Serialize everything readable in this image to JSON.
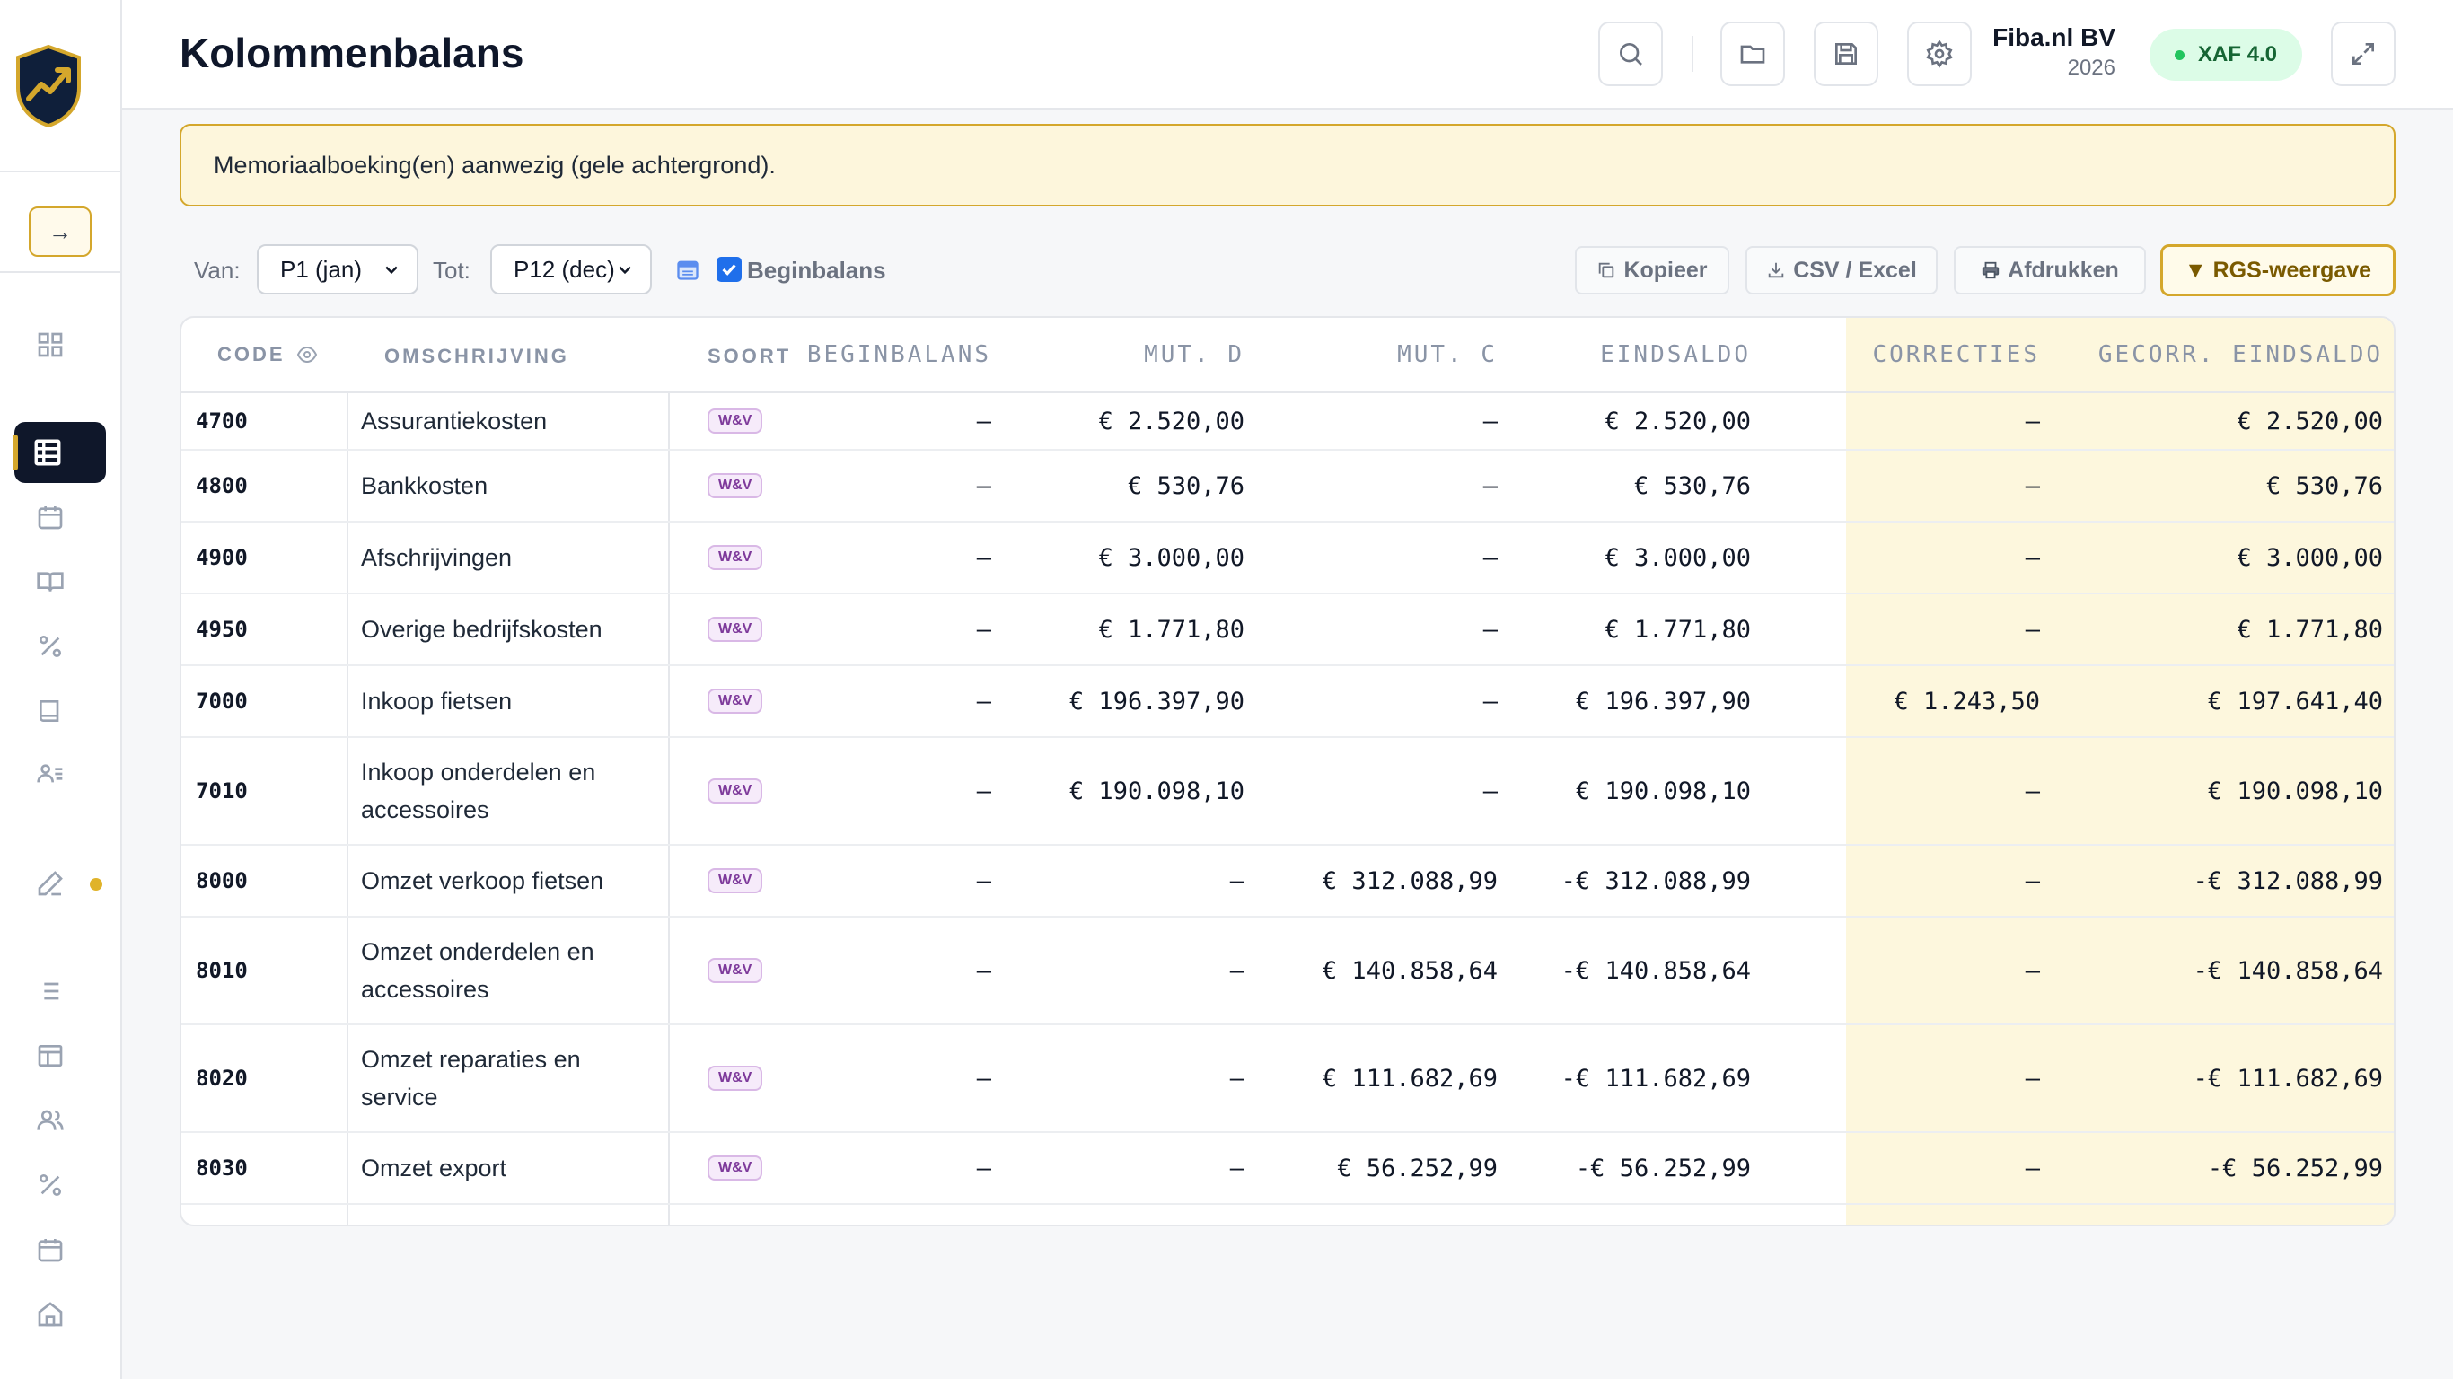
{
  "header": {
    "title": "Kolommenbalans",
    "company_name": "Fiba.nl BV",
    "company_year": "2026",
    "xaf_badge": "XAF 4.0"
  },
  "sidebar": {
    "expand_label": "→",
    "items": [
      {
        "icon": "grid-icon"
      },
      {
        "icon": "table-icon",
        "active": true
      },
      {
        "icon": "calendar-icon"
      },
      {
        "icon": "book-open-icon"
      },
      {
        "icon": "percent-icon"
      },
      {
        "icon": "book-icon"
      },
      {
        "icon": "user-list-icon"
      },
      {
        "icon": "pencil-icon",
        "badge": true
      },
      {
        "icon": "list-icon"
      },
      {
        "icon": "layout-icon"
      },
      {
        "icon": "users-icon"
      },
      {
        "icon": "percent-icon"
      },
      {
        "icon": "calendar-icon"
      },
      {
        "icon": "home-icon"
      }
    ]
  },
  "notice": "Memoriaalboeking(en) aanwezig (gele achtergrond).",
  "toolbar": {
    "from_label": "Van:",
    "from_value": "P1 (jan)",
    "to_label": "Tot:",
    "to_value": "P12 (dec)",
    "opening_balance_label": "Beginbalans",
    "opening_balance_checked": true,
    "copy_label": "Kopieer",
    "csv_label": "CSV / Excel",
    "print_label": "Afdrukken",
    "rgs_label": "▼ RGS-weergave"
  },
  "table": {
    "columns": {
      "code": "CODE",
      "description": "OMSCHRIJVING",
      "type": "SOORT",
      "opening": "BEGINBALANS",
      "debit": "MUT. D",
      "credit": "MUT. C",
      "closing": "EINDSALDO",
      "corrections": "CORRECTIES",
      "corrected": "GECORR. EINDSALDO"
    },
    "rows": [
      {
        "code": "4700",
        "desc": "Assurantiekosten",
        "type": "W&V",
        "opening": "–",
        "debit": "€ 2.520,00",
        "credit": "–",
        "closing": "€ 2.520,00",
        "corrections": "–",
        "corrected": "€ 2.520,00"
      },
      {
        "code": "4800",
        "desc": "Bankkosten",
        "type": "W&V",
        "opening": "–",
        "debit": "€ 530,76",
        "credit": "–",
        "closing": "€ 530,76",
        "corrections": "–",
        "corrected": "€ 530,76"
      },
      {
        "code": "4900",
        "desc": "Afschrijvingen",
        "type": "W&V",
        "opening": "–",
        "debit": "€ 3.000,00",
        "credit": "–",
        "closing": "€ 3.000,00",
        "corrections": "–",
        "corrected": "€ 3.000,00"
      },
      {
        "code": "4950",
        "desc": "Overige bedrijfskosten",
        "type": "W&V",
        "opening": "–",
        "debit": "€ 1.771,80",
        "credit": "–",
        "closing": "€ 1.771,80",
        "corrections": "–",
        "corrected": "€ 1.771,80"
      },
      {
        "code": "7000",
        "desc": "Inkoop fietsen",
        "type": "W&V",
        "opening": "–",
        "debit": "€ 196.397,90",
        "credit": "–",
        "closing": "€ 196.397,90",
        "corrections": "€ 1.243,50",
        "corrected": "€ 197.641,40"
      },
      {
        "code": "7010",
        "desc": "Inkoop onderdelen en accessoires",
        "type": "W&V",
        "opening": "–",
        "debit": "€ 190.098,10",
        "credit": "–",
        "closing": "€ 190.098,10",
        "corrections": "–",
        "corrected": "€ 190.098,10"
      },
      {
        "code": "8000",
        "desc": "Omzet verkoop fietsen",
        "type": "W&V",
        "opening": "–",
        "debit": "–",
        "credit": "€ 312.088,99",
        "closing": "-€ 312.088,99",
        "corrections": "–",
        "corrected": "-€ 312.088,99"
      },
      {
        "code": "8010",
        "desc": "Omzet onderdelen en accessoires",
        "type": "W&V",
        "opening": "–",
        "debit": "–",
        "credit": "€ 140.858,64",
        "closing": "-€ 140.858,64",
        "corrections": "–",
        "corrected": "-€ 140.858,64"
      },
      {
        "code": "8020",
        "desc": "Omzet reparaties en service",
        "type": "W&V",
        "opening": "–",
        "debit": "–",
        "credit": "€ 111.682,69",
        "closing": "-€ 111.682,69",
        "corrections": "–",
        "corrected": "-€ 111.682,69"
      },
      {
        "code": "8030",
        "desc": "Omzet export",
        "type": "W&V",
        "opening": "–",
        "debit": "–",
        "credit": "€ 56.252,99",
        "closing": "-€ 56.252,99",
        "corrections": "–",
        "corrected": "-€ 56.252,99"
      }
    ]
  }
}
